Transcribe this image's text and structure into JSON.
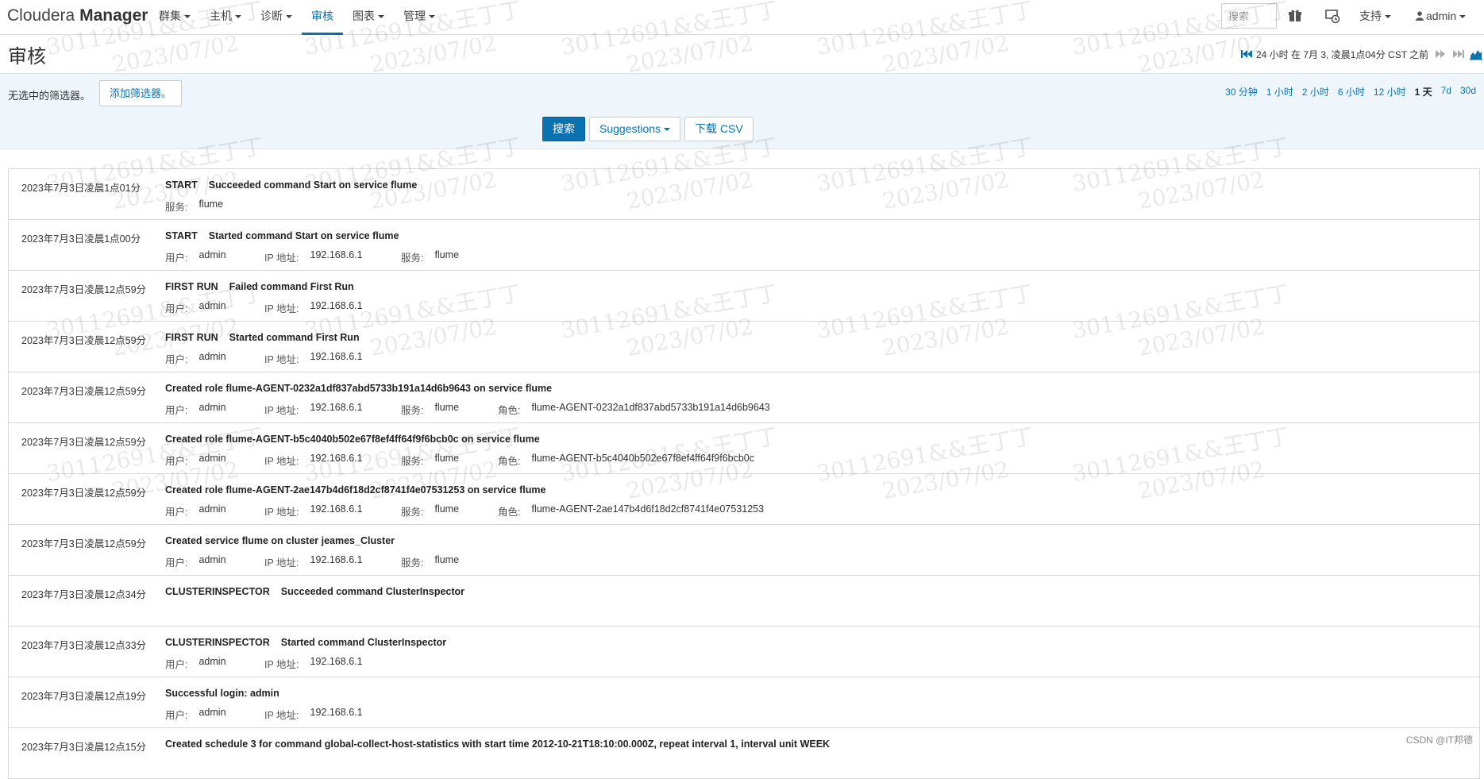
{
  "brand": {
    "light": "Cloudera",
    "bold": "Manager"
  },
  "nav": [
    {
      "label": "群集",
      "caret": true,
      "active": false
    },
    {
      "label": "主机",
      "caret": true,
      "active": false
    },
    {
      "label": "诊断",
      "caret": true,
      "active": false
    },
    {
      "label": "审核",
      "caret": false,
      "active": true
    },
    {
      "label": "图表",
      "caret": true,
      "active": false
    },
    {
      "label": "管理",
      "caret": true,
      "active": false
    }
  ],
  "search": {
    "placeholder": "搜索"
  },
  "support_label": "支持",
  "user_label": "admin",
  "page_title": "审核",
  "time_range_label": "24 小时 在 7月 3, 凌晨1点04分 CST 之前",
  "filters": {
    "none_text": "无选中的筛选器。",
    "add_label": "添加筛选器。"
  },
  "quick_ranges": [
    "30 分钟",
    "1 小时",
    "2 小时",
    "6 小时",
    "12 小时",
    "1 天",
    "7d",
    "30d"
  ],
  "quick_range_selected": "1 天",
  "buttons": {
    "search": "搜索",
    "suggestions": "Suggestions",
    "download": "下载 CSV"
  },
  "attr_labels": {
    "user": "用户:",
    "ip": "IP 地址:",
    "service": "服务:",
    "role": "角色:"
  },
  "events": [
    {
      "time": "2023年7月3日凌晨1点01分",
      "command": "START",
      "message": "Succeeded command Start on service flume",
      "service": "flume"
    },
    {
      "time": "2023年7月3日凌晨1点00分",
      "command": "START",
      "message": "Started command Start on service flume",
      "user": "admin",
      "ip": "192.168.6.1",
      "service": "flume"
    },
    {
      "time": "2023年7月3日凌晨12点59分",
      "command": "FIRST RUN",
      "message": "Failed command First Run",
      "user": "admin",
      "ip": "192.168.6.1"
    },
    {
      "time": "2023年7月3日凌晨12点59分",
      "command": "FIRST RUN",
      "message": "Started command First Run",
      "user": "admin",
      "ip": "192.168.6.1"
    },
    {
      "time": "2023年7月3日凌晨12点59分",
      "message": "Created role flume-AGENT-0232a1df837abd5733b191a14d6b9643 on service flume",
      "user": "admin",
      "ip": "192.168.6.1",
      "service": "flume",
      "role": "flume-AGENT-0232a1df837abd5733b191a14d6b9643"
    },
    {
      "time": "2023年7月3日凌晨12点59分",
      "message": "Created role flume-AGENT-b5c4040b502e67f8ef4ff64f9f6bcb0c on service flume",
      "user": "admin",
      "ip": "192.168.6.1",
      "service": "flume",
      "role": "flume-AGENT-b5c4040b502e67f8ef4ff64f9f6bcb0c"
    },
    {
      "time": "2023年7月3日凌晨12点59分",
      "message": "Created role flume-AGENT-2ae147b4d6f18d2cf8741f4e07531253 on service flume",
      "user": "admin",
      "ip": "192.168.6.1",
      "service": "flume",
      "role": "flume-AGENT-2ae147b4d6f18d2cf8741f4e07531253"
    },
    {
      "time": "2023年7月3日凌晨12点59分",
      "message": "Created service flume on cluster jeames_Cluster",
      "user": "admin",
      "ip": "192.168.6.1",
      "service": "flume"
    },
    {
      "time": "2023年7月3日凌晨12点34分",
      "command": "CLUSTERINSPECTOR",
      "message": "Succeeded command ClusterInspector"
    },
    {
      "time": "2023年7月3日凌晨12点33分",
      "command": "CLUSTERINSPECTOR",
      "message": "Started command ClusterInspector",
      "user": "admin",
      "ip": "192.168.6.1"
    },
    {
      "time": "2023年7月3日凌晨12点19分",
      "message": "Successful login: admin",
      "user": "admin",
      "ip": "192.168.6.1"
    },
    {
      "time": "2023年7月3日凌晨12点15分",
      "message": "Created schedule 3 for command global-collect-host-statistics with start time 2012-10-21T18:10:00.000Z, repeat interval 1, interval unit WEEK"
    }
  ],
  "watermark": {
    "line1": "30112691&&王丁丁",
    "line2": "2023/07/02"
  },
  "footer_credit": "CSDN @IT邦德",
  "colors": {
    "accent": "#0a72b0",
    "filter_band": "#eef6fb"
  }
}
